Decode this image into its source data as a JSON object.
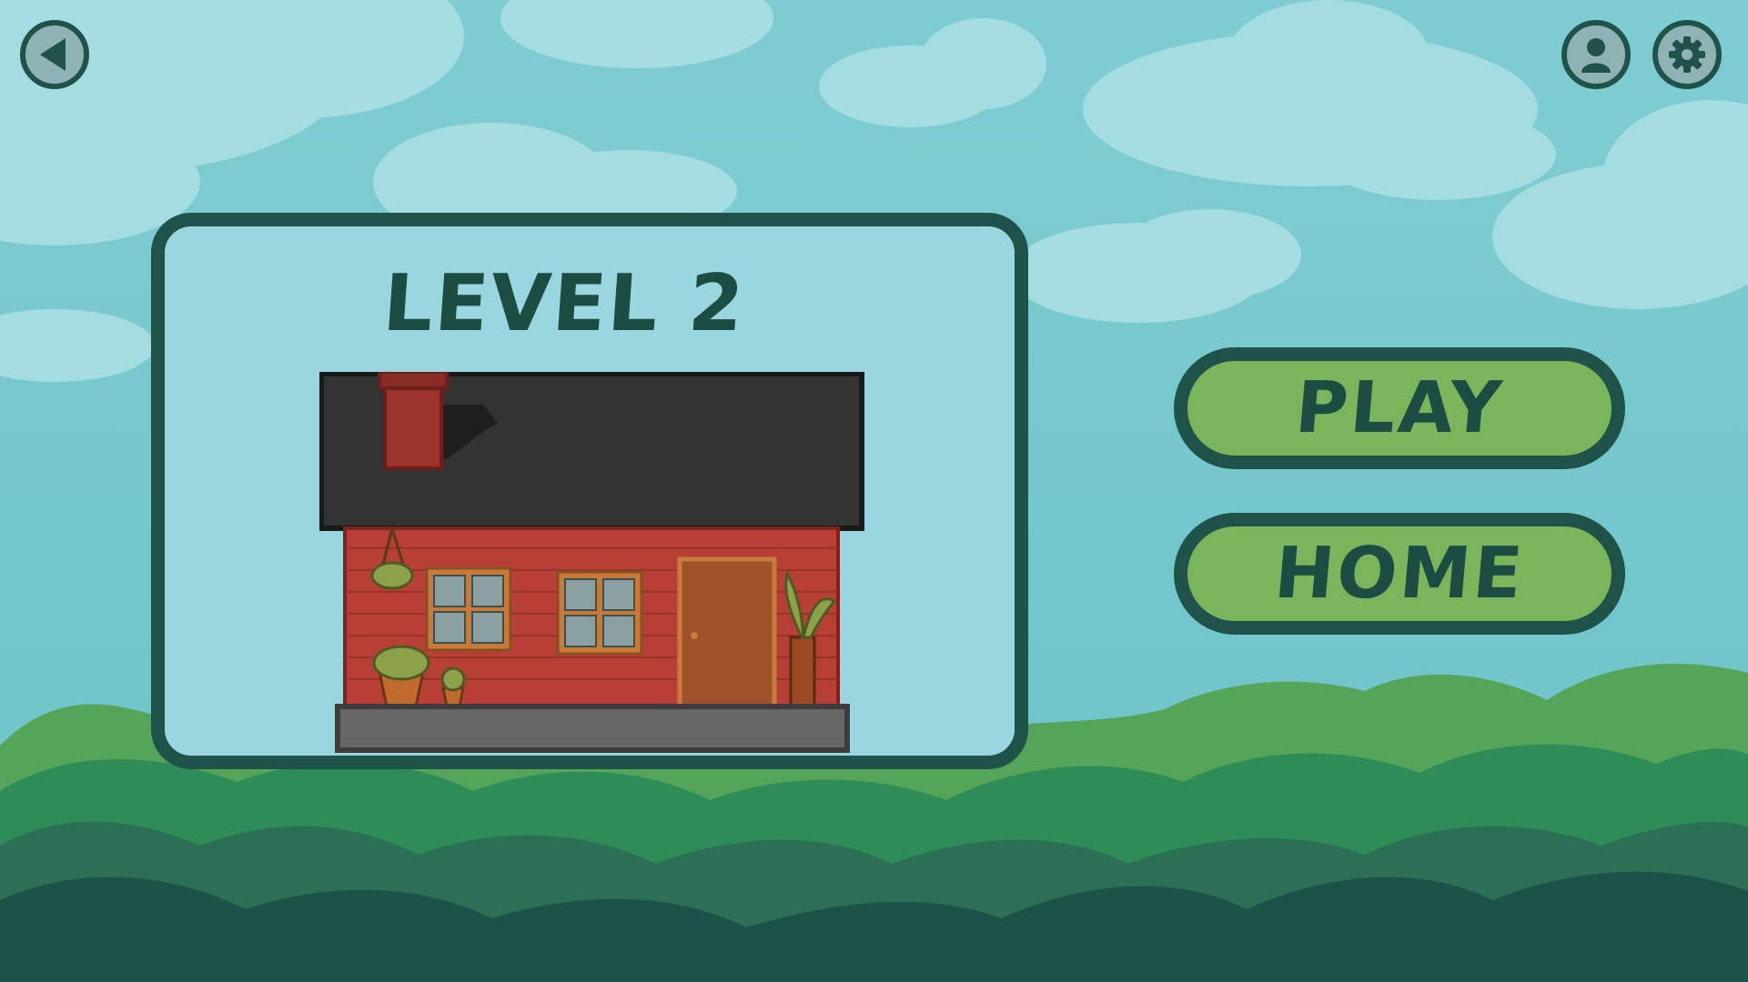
{
  "level": {
    "title": "LEVEL 2"
  },
  "menu": {
    "play_label": "PLAY",
    "home_label": "HOME"
  },
  "top_bar": {
    "back_icon": "back-arrow-icon",
    "profile_icon": "profile-icon",
    "settings_icon": "gear-icon"
  },
  "colors": {
    "sky": "#6fc6cb",
    "panel_fill": "#9ad6df",
    "outline": "#1f5248",
    "button_green": "#7ab55c",
    "text_dark_green": "#1c4d43",
    "brick": "#b83f35",
    "roof": "#333333"
  }
}
